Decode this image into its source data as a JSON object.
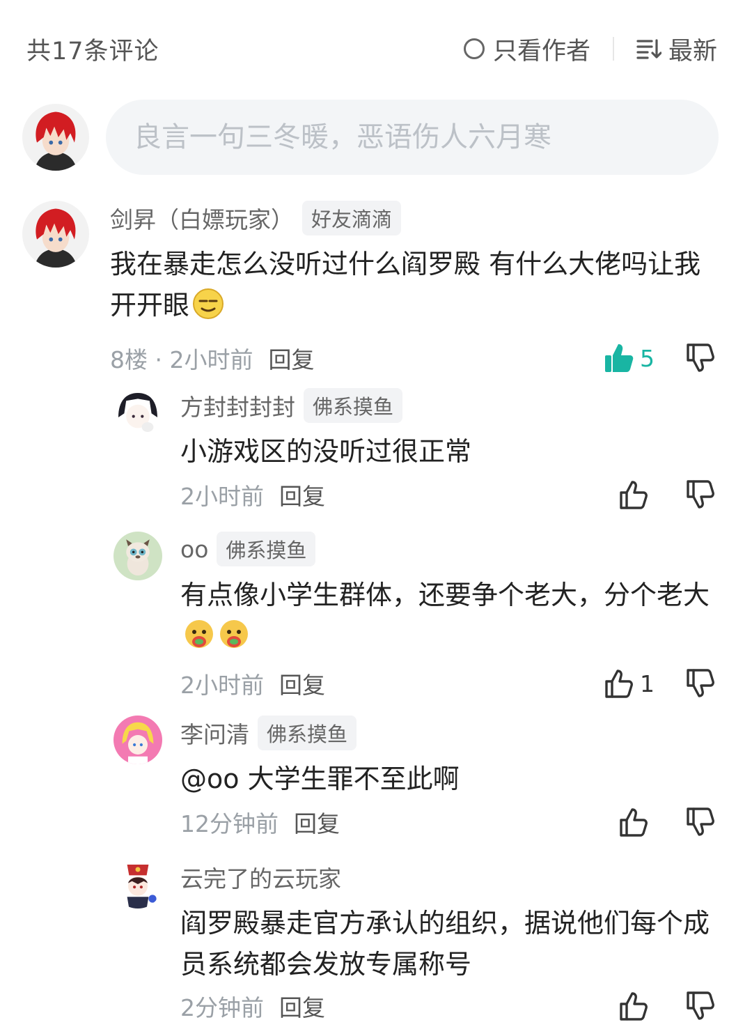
{
  "header": {
    "comment_count": "共17条评论",
    "author_only": "只看作者",
    "sort": "最新"
  },
  "composer": {
    "placeholder": "良言一句三冬暖，恶语伤人六月寒"
  },
  "comments": [
    {
      "name": "剑昇（白嫖玩家）",
      "badge": "好友滴滴",
      "text": "我在暴走怎么没听过什么阎罗殿  有什么大佬吗让我开开眼",
      "meta": "8楼 · 2小时前",
      "reply": "回复",
      "likes": "5",
      "liked": true
    },
    {
      "name": "方封封封封",
      "badge": "佛系摸鱼",
      "text": "小游戏区的没听过很正常",
      "meta": "2小时前",
      "reply": "回复",
      "likes": ""
    },
    {
      "name": "oo",
      "badge": "佛系摸鱼",
      "text": "有点像小学生群体，还要争个老大，分个老大",
      "meta": "2小时前",
      "reply": "回复",
      "likes": "1"
    },
    {
      "name": "李问清",
      "badge": "佛系摸鱼",
      "text": "@oo  大学生罪不至此啊",
      "meta": "12分钟前",
      "reply": "回复",
      "likes": ""
    },
    {
      "name": "云完了的云玩家",
      "badge": "",
      "text": "阎罗殿暴走官方承认的组织，据说他们每个成员系统都会发放专属称号",
      "meta": "2分钟前",
      "reply": "回复",
      "likes": ""
    }
  ],
  "colors": {
    "accent_like": "#19b5a3",
    "muted_text": "#9aa0a6",
    "input_bg": "#f3f5f7"
  }
}
